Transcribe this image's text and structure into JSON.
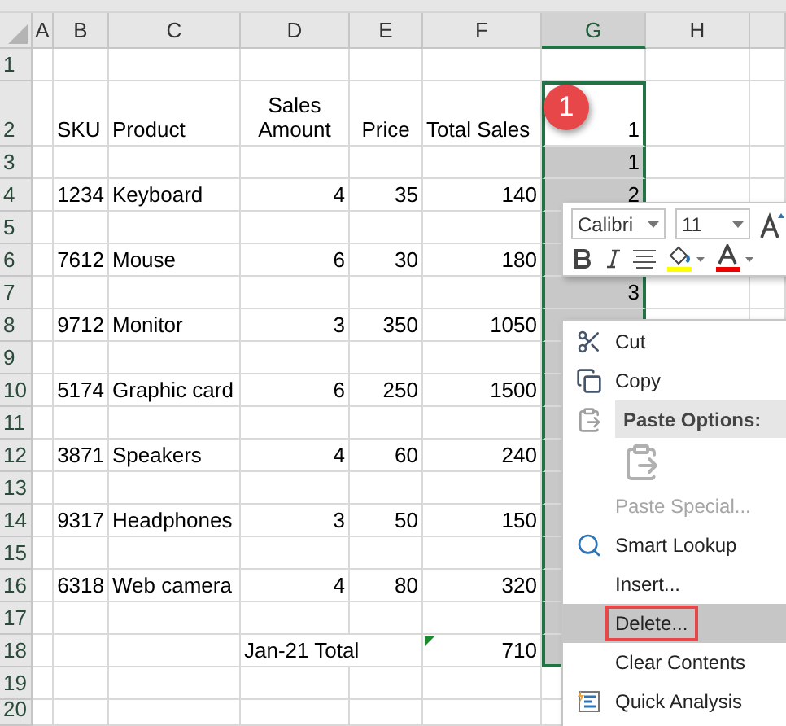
{
  "columns": [
    {
      "label": "A",
      "selected": false
    },
    {
      "label": "B",
      "selected": false
    },
    {
      "label": "C",
      "selected": false
    },
    {
      "label": "D",
      "selected": false
    },
    {
      "label": "E",
      "selected": false
    },
    {
      "label": "F",
      "selected": false
    },
    {
      "label": "G",
      "selected": true
    },
    {
      "label": "H",
      "selected": false
    }
  ],
  "rows": [
    {
      "number": "1",
      "in_selection": false,
      "active": false
    },
    {
      "number": "2",
      "kind": "header",
      "in_selection": true,
      "active": true,
      "cells": [
        null,
        "SKU",
        "Product",
        "Sales Amount",
        "Price",
        "Total Sales",
        "1"
      ]
    },
    {
      "number": "3",
      "in_selection": true,
      "active": false,
      "cells": [
        null,
        null,
        null,
        null,
        null,
        null,
        "1"
      ]
    },
    {
      "number": "4",
      "kind": "item",
      "in_selection": true,
      "active": false,
      "cells": [
        null,
        "1234",
        "Keyboard",
        "4",
        "35",
        "140",
        "2"
      ]
    },
    {
      "number": "5",
      "in_selection": true,
      "active": false
    },
    {
      "number": "6",
      "kind": "item",
      "in_selection": true,
      "active": false,
      "cells": [
        null,
        "7612",
        "Mouse",
        "6",
        "30",
        "180"
      ]
    },
    {
      "number": "7",
      "in_selection": true,
      "active": false,
      "cells": [
        null,
        null,
        null,
        null,
        null,
        null,
        "3"
      ]
    },
    {
      "number": "8",
      "kind": "item",
      "in_selection": true,
      "active": false,
      "cells": [
        null,
        "9712",
        "Monitor",
        "3",
        "350",
        "1050"
      ]
    },
    {
      "number": "9",
      "in_selection": true,
      "active": false
    },
    {
      "number": "10",
      "kind": "item",
      "in_selection": true,
      "active": false,
      "cells": [
        null,
        "5174",
        "Graphic card",
        "6",
        "250",
        "1500"
      ]
    },
    {
      "number": "11",
      "in_selection": true,
      "active": false
    },
    {
      "number": "12",
      "kind": "item",
      "in_selection": true,
      "active": false,
      "cells": [
        null,
        "3871",
        "Speakers",
        "4",
        "60",
        "240"
      ]
    },
    {
      "number": "13",
      "in_selection": true,
      "active": false
    },
    {
      "number": "14",
      "kind": "item",
      "in_selection": true,
      "active": false,
      "cells": [
        null,
        "9317",
        "Headphones",
        "3",
        "50",
        "150"
      ]
    },
    {
      "number": "15",
      "in_selection": true,
      "active": false
    },
    {
      "number": "16",
      "kind": "item",
      "in_selection": true,
      "active": false,
      "cells": [
        null,
        "6318",
        "Web camera",
        "4",
        "80",
        "320"
      ]
    },
    {
      "number": "17",
      "in_selection": true,
      "active": false
    },
    {
      "number": "18",
      "kind": "total",
      "in_selection": true,
      "active": false,
      "cells": [
        null,
        null,
        null,
        "Jan-21 Total",
        null,
        "710"
      ]
    },
    {
      "number": "19",
      "in_selection": false,
      "active": false
    },
    {
      "number": "20",
      "in_selection": false,
      "active": false
    }
  ],
  "callout": "1",
  "mini_toolbar": {
    "font": "Calibri",
    "size": "11"
  },
  "context_menu": [
    {
      "kind": "item",
      "label": "Cut",
      "disabled": false,
      "selected": false
    },
    {
      "kind": "item",
      "label": "Copy",
      "disabled": false,
      "selected": false
    },
    {
      "kind": "header",
      "label": "Paste Options:"
    },
    {
      "kind": "paste"
    },
    {
      "kind": "item",
      "label": "Paste Special...",
      "disabled": true,
      "selected": false
    },
    {
      "kind": "item",
      "label": "Smart Lookup",
      "disabled": false,
      "selected": false
    },
    {
      "kind": "item",
      "label": "Insert...",
      "disabled": false,
      "selected": false
    },
    {
      "kind": "item",
      "label": "Delete...",
      "disabled": false,
      "selected": true
    },
    {
      "kind": "item",
      "label": "Clear Contents",
      "disabled": false,
      "selected": false
    },
    {
      "kind": "item",
      "label": "Quick Analysis",
      "disabled": false,
      "selected": false
    }
  ]
}
